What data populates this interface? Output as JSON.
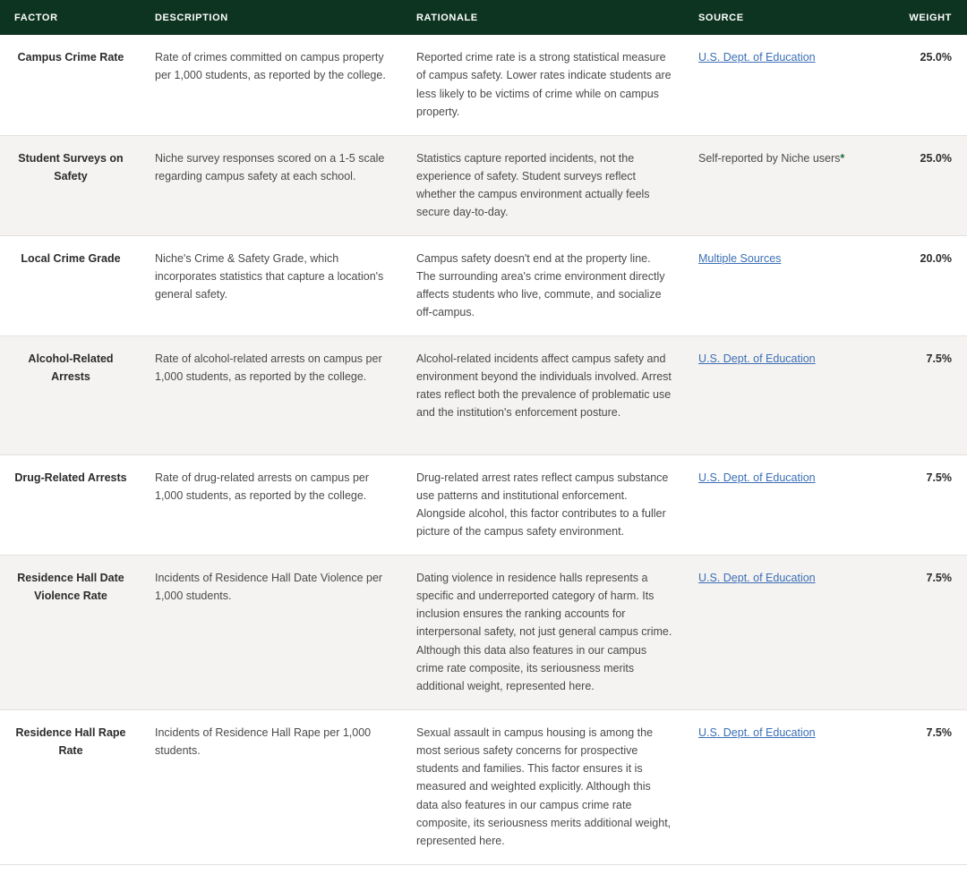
{
  "table": {
    "headers": {
      "factor": "FACTOR",
      "description": "DESCRIPTION",
      "rationale": "RATIONALE",
      "source": "SOURCE",
      "weight": "WEIGHT"
    },
    "rows": [
      {
        "factor": "Campus Crime Rate",
        "description": "Rate of crimes committed on campus property per 1,000 students, as reported by the college.",
        "rationale": "Reported crime rate is a strong statistical measure of campus safety. Lower rates indicate students are less likely to be victims of crime while on campus property.",
        "source": "U.S. Dept. of Education",
        "weight": "25.0%"
      },
      {
        "factor": "Student Surveys on Safety",
        "description": "Niche survey responses scored on a 1-5 scale regarding campus safety at each school.",
        "rationale": "Statistics capture reported incidents, not the experience of safety. Student surveys reflect whether the campus environment actually feels secure day-to-day.",
        "source": "Self-reported by Niche users",
        "source_mark": "*",
        "weight": "25.0%"
      },
      {
        "factor": "Local Crime Grade",
        "description": "Niche's Crime & Safety Grade, which incorporates statistics that capture a location's general safety.",
        "rationale": "Campus safety doesn't end at the property line. The surrounding area's crime environment directly affects students who live, commute, and socialize off-campus.",
        "source": "Multiple Sources",
        "weight": "20.0%"
      },
      {
        "factor": "Alcohol-Related Arrests",
        "description": "Rate of alcohol-related arrests on campus per 1,000 students, as reported by the college.",
        "rationale": "Alcohol-related incidents affect campus safety and environment beyond the individuals involved. Arrest rates reflect both the prevalence of problematic use and the institution's enforcement posture.",
        "source": "U.S. Dept. of Education",
        "weight": "7.5%"
      },
      {
        "factor": "Drug-Related Arrests",
        "description": "Rate of drug-related arrests on campus per 1,000 students, as reported by the college.",
        "rationale": "Drug-related arrest rates reflect campus substance use patterns and institutional enforcement. Alongside alcohol, this factor contributes to a fuller picture of the campus safety environment.",
        "source": "U.S. Dept. of Education",
        "weight": "7.5%"
      },
      {
        "factor": "Residence Hall Date Violence Rate",
        "description": "Incidents of Residence Hall Date Violence per 1,000 students.",
        "rationale": "Dating violence in residence halls represents a specific and underreported category of harm. Its inclusion ensures the ranking accounts for interpersonal safety, not just general campus crime. Although this data also features in our campus crime rate composite, its seriousness merits additional weight, represented here.",
        "source": "U.S. Dept. of Education",
        "weight": "7.5%"
      },
      {
        "factor": "Residence Hall Rape Rate",
        "description": "Incidents of Residence Hall Rape per 1,000 students.",
        "rationale": "Sexual assault in campus housing is among the most serious safety concerns for prospective students and families. This factor ensures it is measured and weighted explicitly. Although this data also features in our campus crime rate composite, its seriousness merits additional weight, represented here.",
        "source": "U.S. Dept. of Education",
        "weight": "7.5%"
      }
    ]
  },
  "colors": {
    "header_bg": "#0d3421",
    "link": "#3b6fb6",
    "alt_row_bg": "#f5f3f1"
  }
}
